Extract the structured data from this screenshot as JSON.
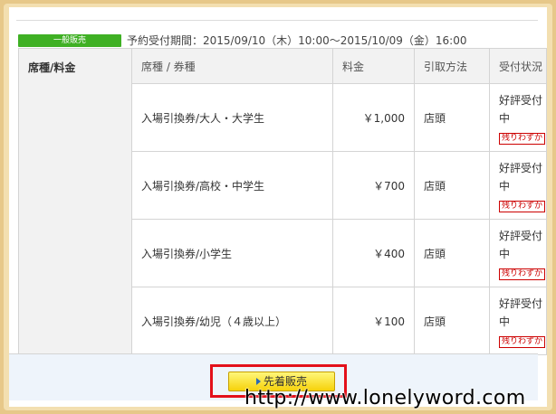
{
  "sale_badge": "一般販売",
  "period_text": "予約受付期間：2015/09/10（木）10:00～2015/10/09（金）16:00",
  "table": {
    "seat_header": "席種/料金",
    "columns": [
      "席種 / 券種",
      "料金",
      "引取方法",
      "受付状況"
    ],
    "rows": [
      {
        "name": "入場引換券/大人・大学生",
        "price": "￥1,000",
        "method": "店頭",
        "status": "好評受付中",
        "remain": "残りわずか"
      },
      {
        "name": "入場引換券/高校・中学生",
        "price": "￥700",
        "method": "店頭",
        "status": "好評受付中",
        "remain": "残りわずか"
      },
      {
        "name": "入場引換券/小学生",
        "price": "￥400",
        "method": "店頭",
        "status": "好評受付中",
        "remain": "残りわずか"
      },
      {
        "name": "入場引換券/幼児（４歳以上）",
        "price": "￥100",
        "method": "店頭",
        "status": "好評受付中",
        "remain": "残りわずか"
      }
    ]
  },
  "cta_label": "先着販売",
  "watermark": "http://www.lonelyword.com",
  "colors": {
    "badge_green": "#3fb024",
    "cta_yellow": "#f6d20a",
    "highlight_red": "#e3101a",
    "frame_beige": "#e7c889"
  }
}
